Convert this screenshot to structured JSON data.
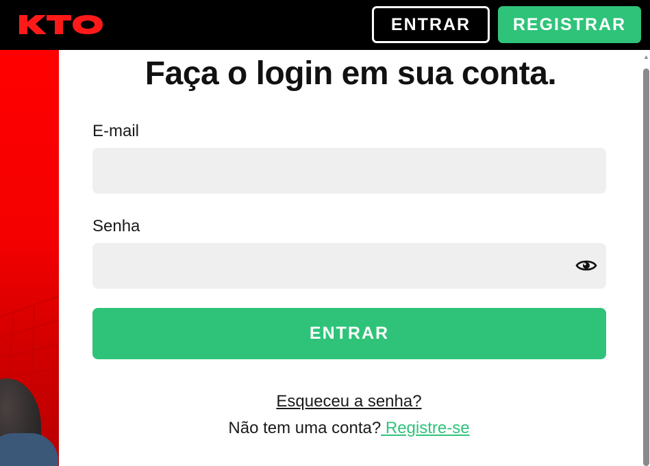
{
  "header": {
    "logo_text": "KTO",
    "login_label": "ENTRAR",
    "register_label": "REGISTRAR"
  },
  "form": {
    "title": "Faça o login em sua conta.",
    "email_label": "E-mail",
    "email_value": "",
    "password_label": "Senha",
    "password_value": "",
    "submit_label": "ENTRAR",
    "forgot_label": "Esqueceu a senha?",
    "no_account_text": "Não tem uma conta?",
    "signup_link_label": " Registre-se"
  },
  "icons": {
    "show_password": "eye-icon",
    "scroll_up": "chevron-up-icon"
  },
  "colors": {
    "brand_red": "#ff0000",
    "accent_green": "#2fc37a",
    "header_bg": "#000000",
    "input_bg": "#efefef"
  }
}
